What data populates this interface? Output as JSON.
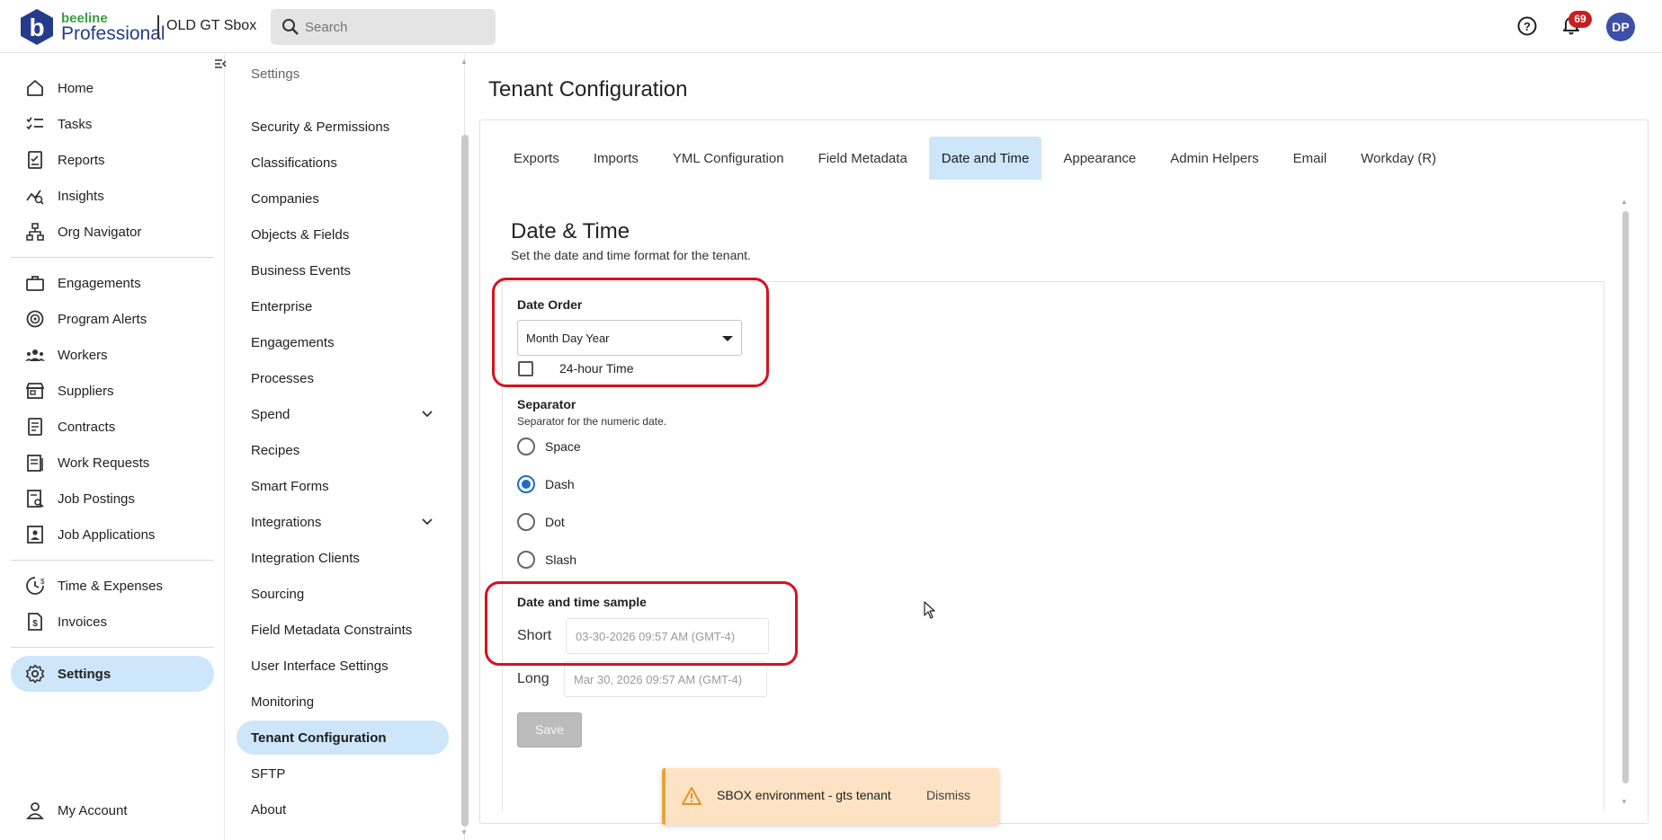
{
  "header": {
    "brand_top": "beeline",
    "brand_bottom": "Professional",
    "environment": "OLD GT Sbox",
    "search_placeholder": "Search",
    "notification_count": "69",
    "avatar_initials": "DP"
  },
  "leftnav": {
    "items": [
      {
        "label": "Home",
        "icon": "home-icon"
      },
      {
        "label": "Tasks",
        "icon": "tasks-icon"
      },
      {
        "label": "Reports",
        "icon": "reports-icon"
      },
      {
        "label": "Insights",
        "icon": "insights-icon"
      },
      {
        "label": "Org Navigator",
        "icon": "org-navigator-icon"
      },
      {
        "label": "Engagements",
        "icon": "briefcase-icon"
      },
      {
        "label": "Program Alerts",
        "icon": "alerts-icon"
      },
      {
        "label": "Workers",
        "icon": "workers-icon"
      },
      {
        "label": "Suppliers",
        "icon": "store-icon"
      },
      {
        "label": "Contracts",
        "icon": "contract-icon"
      },
      {
        "label": "Work Requests",
        "icon": "work-requests-icon"
      },
      {
        "label": "Job Postings",
        "icon": "job-postings-icon"
      },
      {
        "label": "Job Applications",
        "icon": "job-applications-icon"
      },
      {
        "label": "Time & Expenses",
        "icon": "clock-icon"
      },
      {
        "label": "Invoices",
        "icon": "invoice-icon"
      },
      {
        "label": "Settings",
        "icon": "gear-icon"
      },
      {
        "label": "My Account",
        "icon": "person-icon"
      }
    ]
  },
  "subnav": {
    "title": "Settings",
    "items": [
      {
        "label": "Security & Permissions"
      },
      {
        "label": "Classifications"
      },
      {
        "label": "Companies"
      },
      {
        "label": "Objects & Fields"
      },
      {
        "label": "Business Events"
      },
      {
        "label": "Enterprise"
      },
      {
        "label": "Engagements"
      },
      {
        "label": "Processes"
      },
      {
        "label": "Spend",
        "expandable": true
      },
      {
        "label": "Recipes"
      },
      {
        "label": "Smart Forms"
      },
      {
        "label": "Integrations",
        "expandable": true
      },
      {
        "label": "Integration Clients"
      },
      {
        "label": "Sourcing"
      },
      {
        "label": "Field Metadata Constraints"
      },
      {
        "label": "User Interface Settings"
      },
      {
        "label": "Monitoring"
      },
      {
        "label": "Tenant Configuration",
        "active": true
      },
      {
        "label": "SFTP"
      },
      {
        "label": "About"
      }
    ]
  },
  "main": {
    "page_title": "Tenant Configuration",
    "tabs": [
      {
        "label": "Exports"
      },
      {
        "label": "Imports"
      },
      {
        "label": "YML Configuration"
      },
      {
        "label": "Field Metadata"
      },
      {
        "label": "Date and Time",
        "active": true
      },
      {
        "label": "Appearance"
      },
      {
        "label": "Admin Helpers"
      },
      {
        "label": "Email"
      },
      {
        "label": "Workday (R)"
      }
    ],
    "section_title": "Date & Time",
    "section_subtitle": "Set the date and time format for the tenant.",
    "date_order": {
      "label": "Date Order",
      "value": "Month Day Year"
    },
    "hour24": {
      "label": "24-hour Time",
      "checked": false
    },
    "separator": {
      "label": "Separator",
      "help": "Separator for the numeric date.",
      "options": [
        {
          "label": "Space",
          "checked": false
        },
        {
          "label": "Dash",
          "checked": true
        },
        {
          "label": "Dot",
          "checked": false
        },
        {
          "label": "Slash",
          "checked": false
        }
      ]
    },
    "sample": {
      "label": "Date and time sample",
      "short_label": "Short",
      "short_value": "03-30-2026 09:57 AM (GMT-4)",
      "long_label": "Long",
      "long_value": "Mar 30, 2026 09:57 AM (GMT-4)"
    },
    "save_label": "Save"
  },
  "toast": {
    "text": "SBOX environment - gts tenant",
    "dismiss": "Dismiss"
  },
  "colors": {
    "accent_blue": "#1a6fc4",
    "active_bg": "#cde6fa",
    "highlight_red": "#d5121f",
    "badge_red": "#c81e1e",
    "toast_bg": "#fde3c3"
  }
}
